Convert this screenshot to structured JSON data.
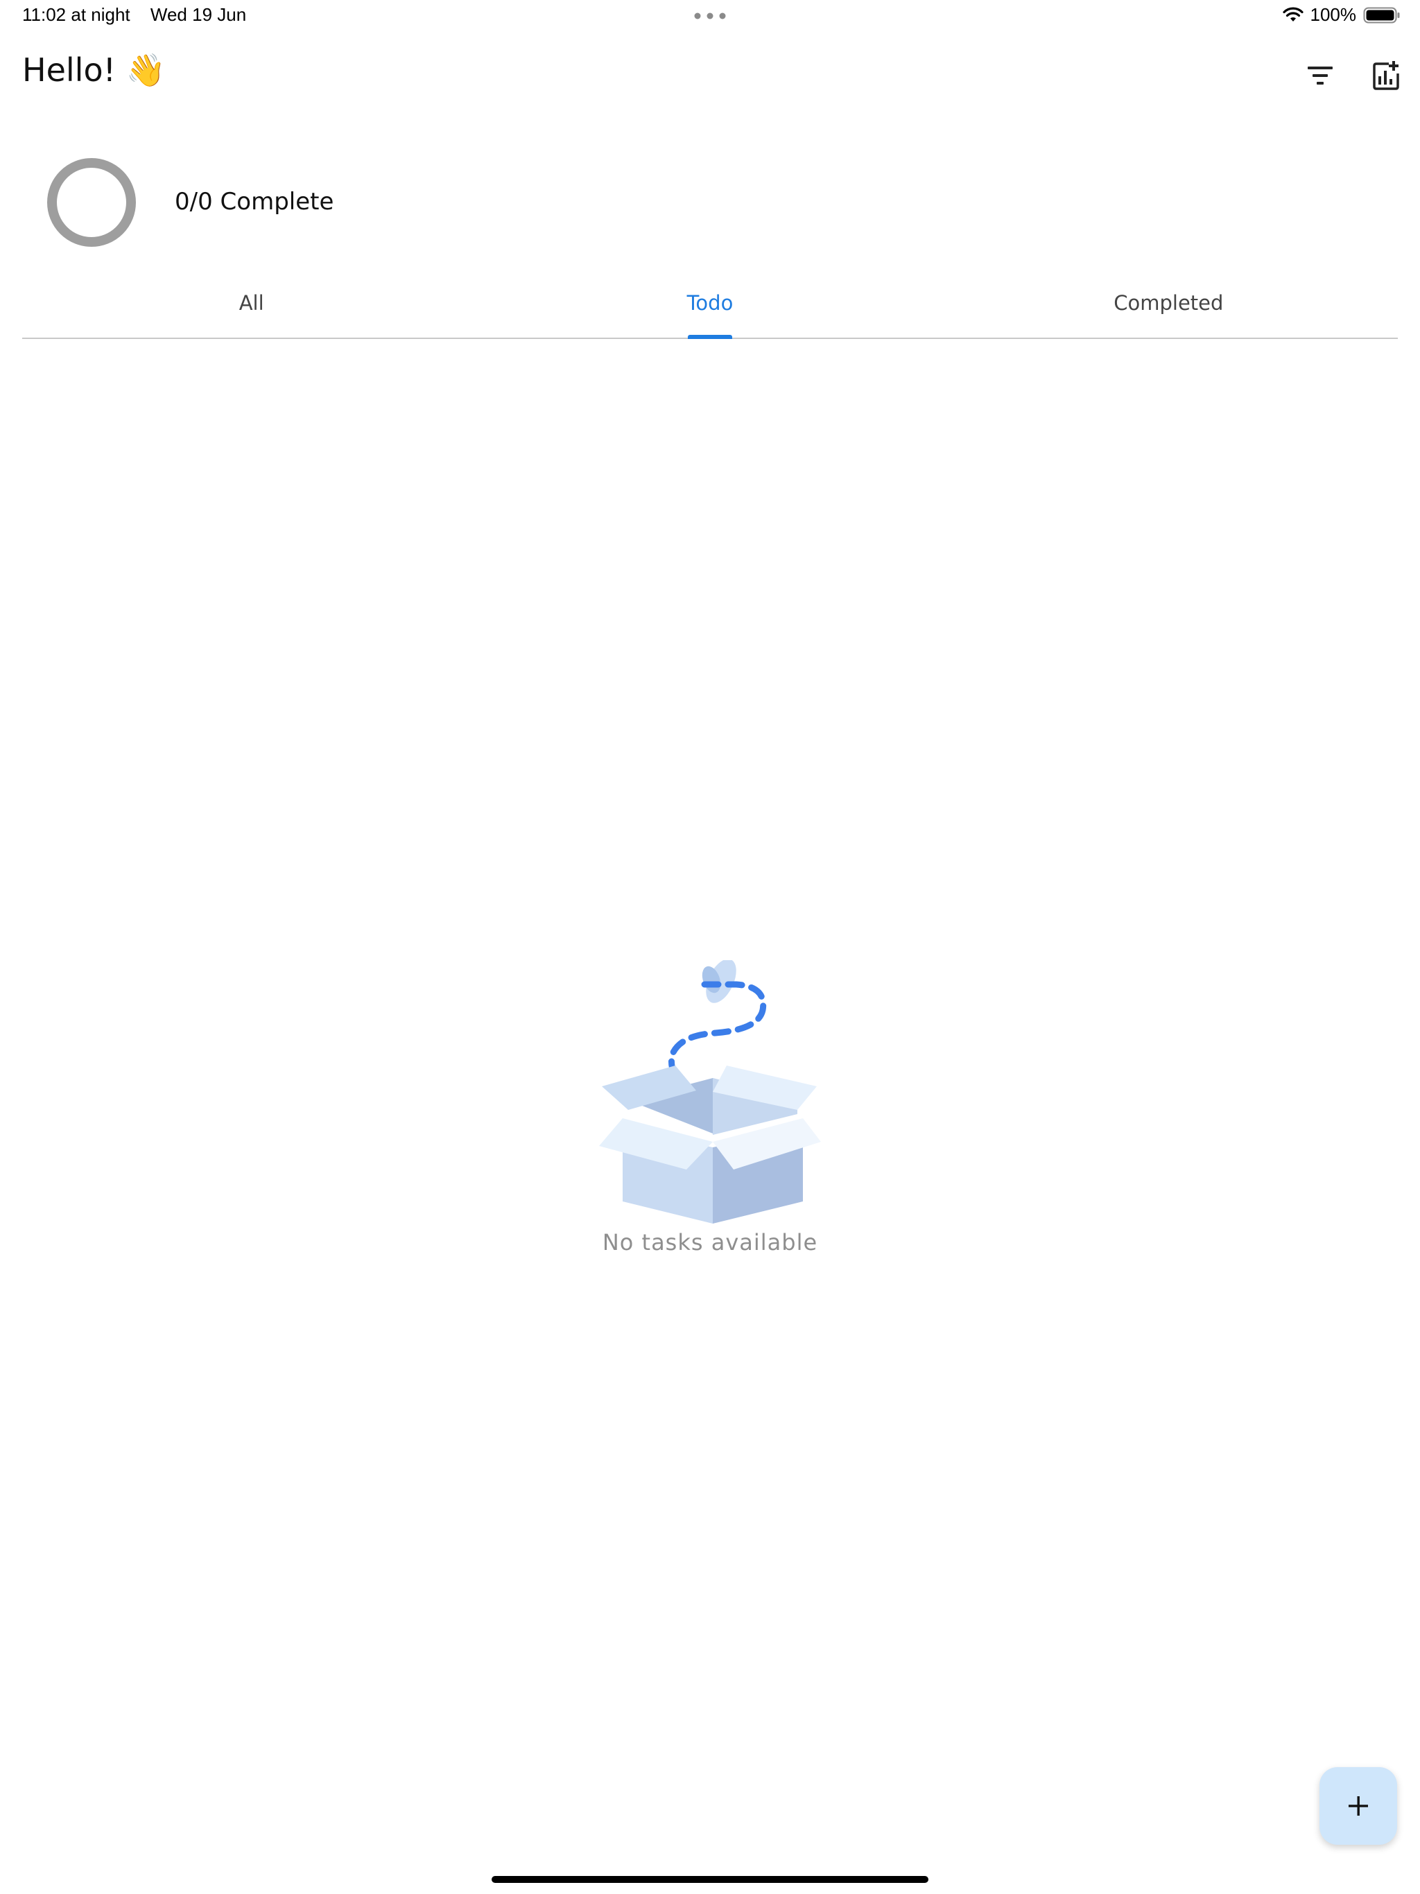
{
  "status_bar": {
    "time": "11:02 at night",
    "date": "Wed 19 Jun",
    "battery_percent": "100%",
    "battery_level": 1.0
  },
  "header": {
    "greeting": "Hello! 👋",
    "filter_icon": "filter-list-icon",
    "stats_icon": "add-chart-icon"
  },
  "progress": {
    "label": "0/0 Complete",
    "completed": 0,
    "total": 0,
    "ring_color": "#9e9e9e"
  },
  "tabs": [
    {
      "label": "All",
      "active": false
    },
    {
      "label": "Todo",
      "active": true
    },
    {
      "label": "Completed",
      "active": false
    }
  ],
  "empty_state": {
    "illustration": "open-box-icon",
    "message": "No tasks available"
  },
  "fab": {
    "icon": "plus-icon"
  },
  "colors": {
    "accent": "#1e7ce0",
    "fab_background": "#cfe6fb",
    "muted_text": "#8e8e8e"
  }
}
